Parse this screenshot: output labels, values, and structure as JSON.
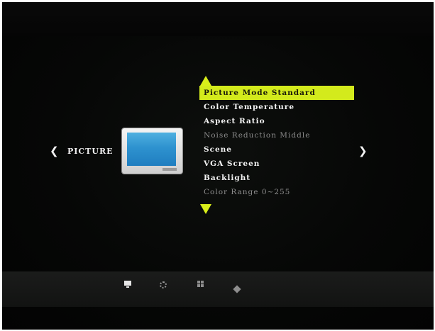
{
  "osd": {
    "section_title": "PICTURE",
    "nav_left_glyph": "❮",
    "nav_right_glyph": "❯",
    "accent_color": "#d3ea1c",
    "menu_items": [
      {
        "label": "Picture Mode Standard",
        "state": "selected"
      },
      {
        "label": "Color Temperature",
        "state": "enabled"
      },
      {
        "label": "Aspect Ratio",
        "state": "enabled"
      },
      {
        "label": "Noise Reduction Middle",
        "state": "disabled"
      },
      {
        "label": "Scene",
        "state": "enabled"
      },
      {
        "label": "VGA Screen",
        "state": "enabled"
      },
      {
        "label": "Backlight",
        "state": "enabled"
      },
      {
        "label": "Color Range 0~255",
        "state": "disabled"
      }
    ],
    "preview_icon": "monitor-icon",
    "bottom_tabs": [
      {
        "icon": "tv-icon",
        "active": true
      },
      {
        "icon": "gear-icon",
        "active": false
      },
      {
        "icon": "grid-icon",
        "active": false
      },
      {
        "icon": "cube-icon",
        "active": false
      }
    ]
  }
}
